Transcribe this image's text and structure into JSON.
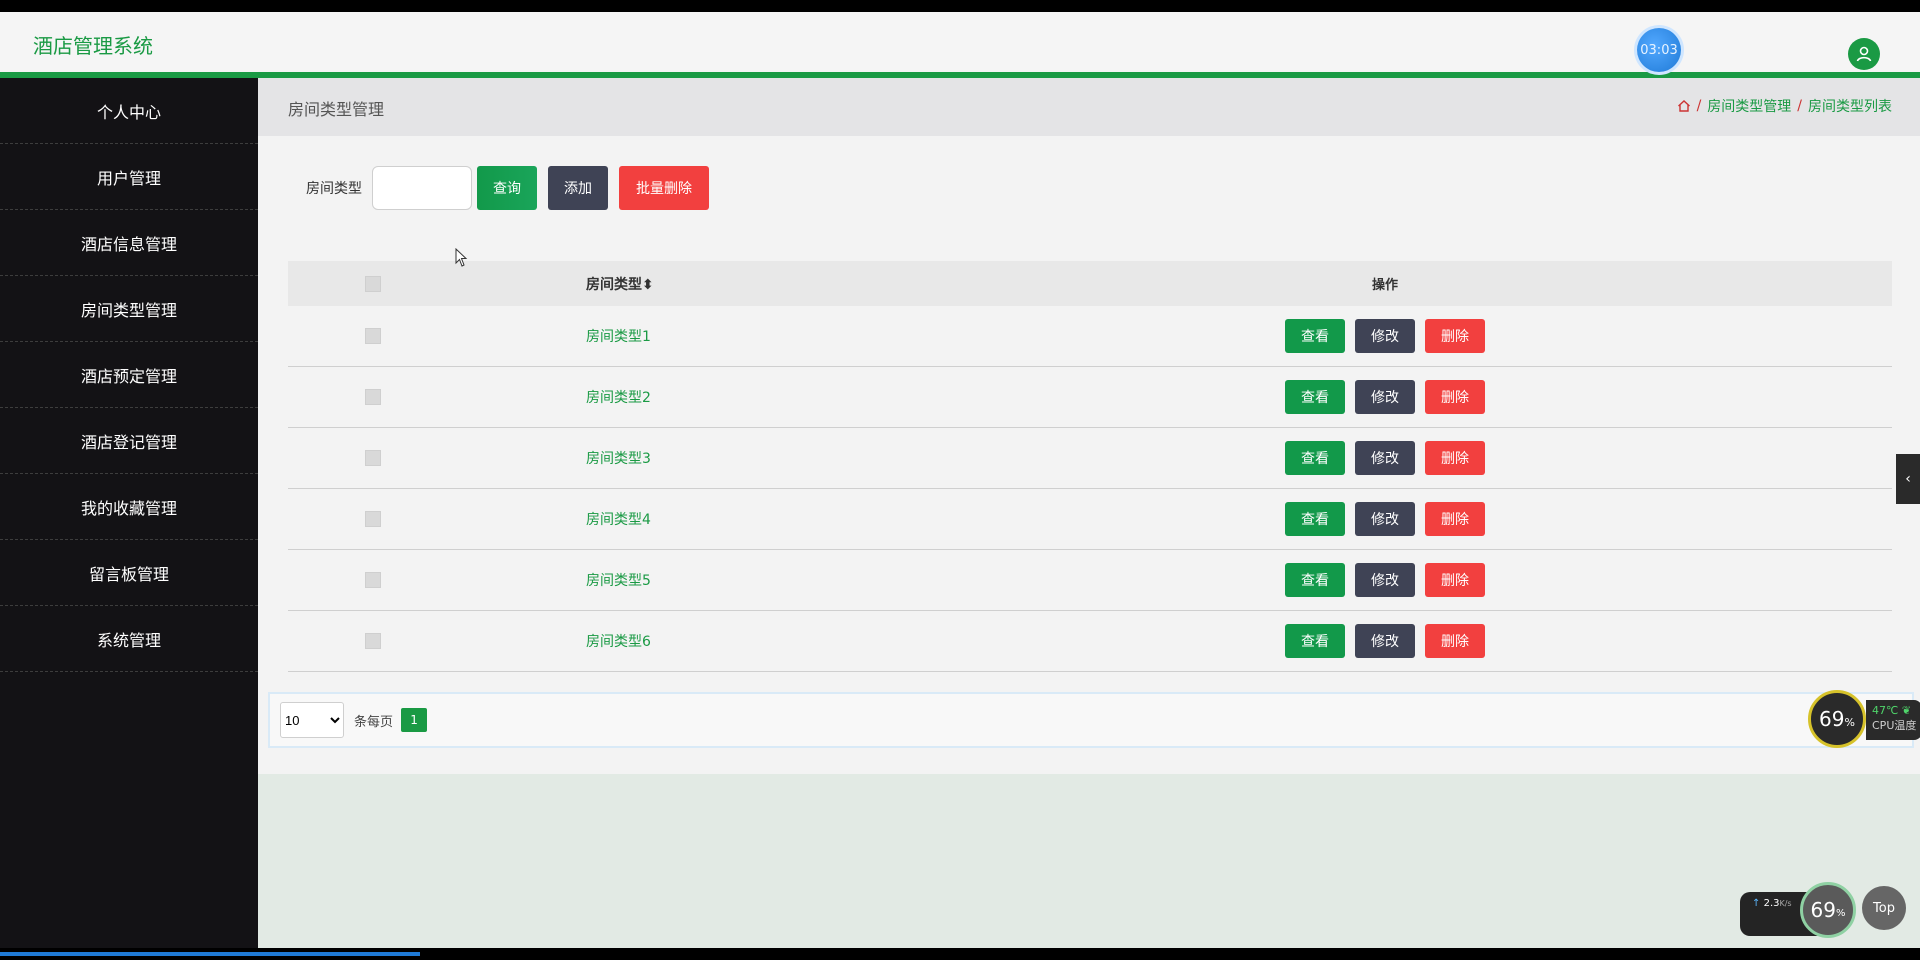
{
  "header": {
    "app_title": "酒店管理系统",
    "clock": "03:03"
  },
  "sidebar": {
    "items": [
      {
        "label": "个人中心"
      },
      {
        "label": "用户管理"
      },
      {
        "label": "酒店信息管理"
      },
      {
        "label": "房间类型管理"
      },
      {
        "label": "酒店预定管理"
      },
      {
        "label": "酒店登记管理"
      },
      {
        "label": "我的收藏管理"
      },
      {
        "label": "留言板管理"
      },
      {
        "label": "系统管理"
      }
    ]
  },
  "main": {
    "page_title": "房间类型管理",
    "breadcrumb": [
      "房间类型管理",
      "房间类型列表"
    ],
    "search": {
      "label": "房间类型",
      "value": "",
      "placeholder": "",
      "search_button": "查询",
      "add_button": "添加",
      "batch_delete_button": "批量删除"
    },
    "table": {
      "headers": [
        "房间类型",
        "操作"
      ],
      "sort_icon": "sort-icon",
      "rows": [
        {
          "type": "房间类型1"
        },
        {
          "type": "房间类型2"
        },
        {
          "type": "房间类型3"
        },
        {
          "type": "房间类型4"
        },
        {
          "type": "房间类型5"
        },
        {
          "type": "房间类型6"
        }
      ],
      "actions": {
        "view": "查看",
        "edit": "修改",
        "delete": "删除"
      }
    },
    "pager": {
      "page_size": "10",
      "per_page_label": "条每页",
      "current_page": "1"
    }
  },
  "widgets": {
    "cpu_percent": "69",
    "cpu_percent_unit": "%",
    "cpu_temp": "47℃",
    "cpu_label": "CPU温度",
    "net_upload": "2.3",
    "net_upload_unit": "K/s",
    "net_percent": "69",
    "net_percent_unit": "%",
    "top_button": "Top"
  },
  "colors": {
    "accent": "#1a9a44",
    "sidebar_bg": "#131215",
    "danger": "#f2403f",
    "dark_button": "#3f4355"
  }
}
